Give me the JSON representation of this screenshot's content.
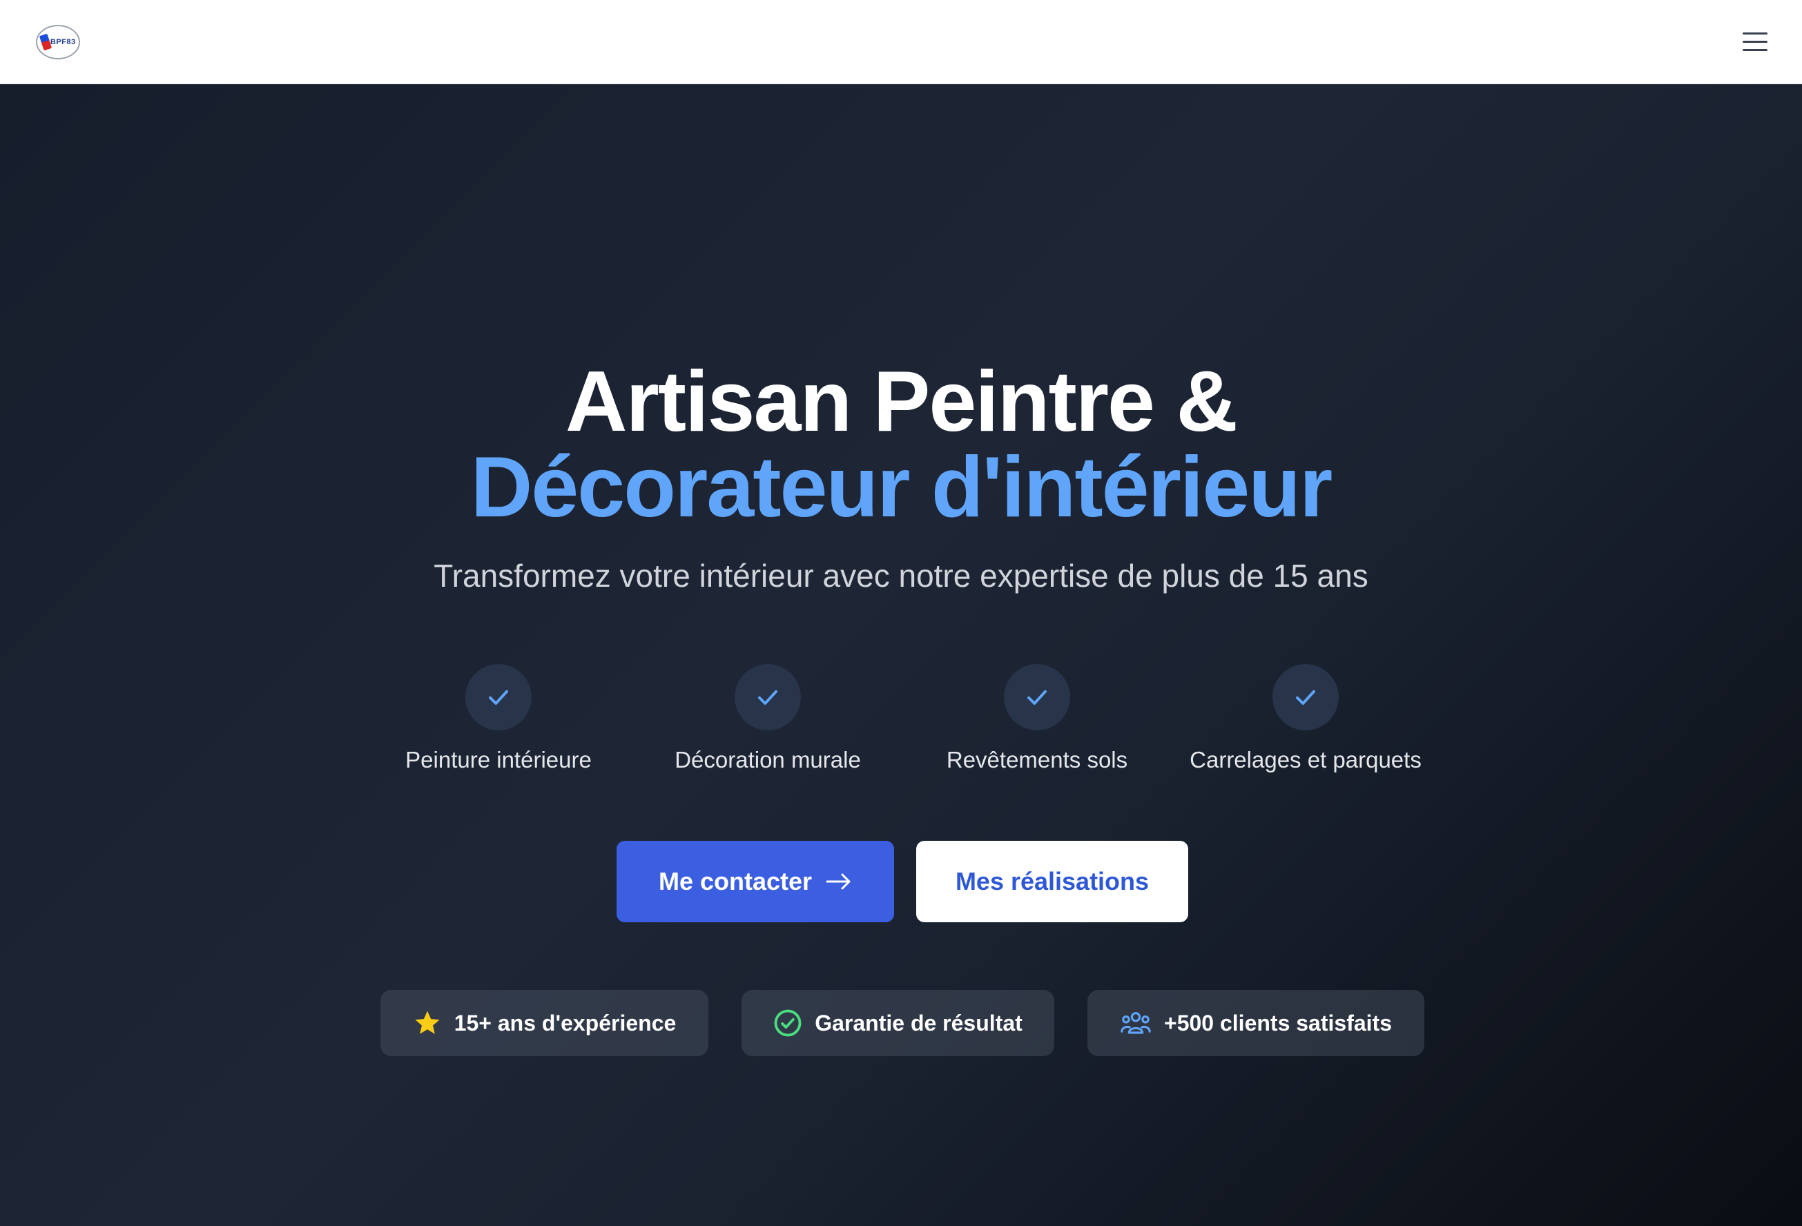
{
  "header": {
    "logo_text": "ABPF83",
    "menu_icon": "hamburger-menu-icon"
  },
  "hero": {
    "title_line1": "Artisan Peintre &",
    "title_line2": "Décorateur d'intérieur",
    "subtitle": "Transformez votre intérieur avec notre expertise de plus de 15 ans",
    "features": [
      {
        "label": "Peinture intérieure",
        "icon": "check-icon"
      },
      {
        "label": "Décoration murale",
        "icon": "check-icon"
      },
      {
        "label": "Revêtements sols",
        "icon": "check-icon"
      },
      {
        "label": "Carrelages et parquets",
        "icon": "check-icon"
      }
    ],
    "buttons": {
      "contact_label": "Me contacter",
      "realisations_label": "Mes réalisations"
    },
    "badges": [
      {
        "label": "15+ ans d'expérience",
        "icon": "star-icon",
        "color": "#facc15"
      },
      {
        "label": "Garantie de résultat",
        "icon": "check-circle-icon",
        "color": "#4ade80"
      },
      {
        "label": "+500 clients satisfaits",
        "icon": "users-icon",
        "color": "#60a5fa"
      }
    ]
  },
  "colors": {
    "accent_blue": "#60a5fa",
    "primary_button": "#3b5fe0",
    "secondary_button_text": "#2f58d6"
  }
}
